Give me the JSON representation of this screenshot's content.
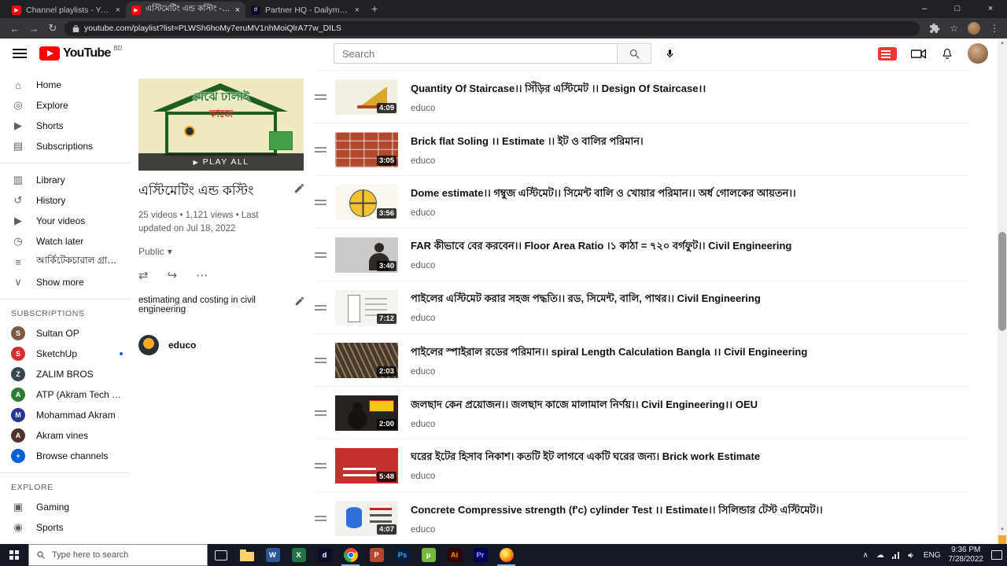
{
  "browser": {
    "tabs": [
      {
        "id": "channel-playlists",
        "title": "Channel playlists - YouTube Stud",
        "favicon_color": "#ff0000",
        "favicon_glyph": "▶",
        "active": false
      },
      {
        "id": "playlist",
        "title": "এস্টিমেটিং এন্ড কস্টিং - YouTube",
        "favicon_color": "#ff0000",
        "favicon_glyph": "▶",
        "active": true
      },
      {
        "id": "dailymotion",
        "title": "Partner HQ - Dailymotion",
        "favicon_color": "#0d0d2b",
        "favicon_glyph": "d",
        "active": false
      }
    ],
    "url": "youtube.com/playlist?list=PLWSh6hoMy7eruMV1nhMoiQlrA77w_DILS",
    "nav": {
      "back": "←",
      "forward": "→",
      "reload": "↻"
    },
    "controls": {
      "minimize": "–",
      "maximize": "□",
      "close": "×",
      "new_tab": "+",
      "close_tab": "×"
    },
    "toolbar_icons": {
      "star": "☆",
      "menu": "⋮"
    }
  },
  "header": {
    "logo_text": "YouTube",
    "country": "BD",
    "search_placeholder": "Search"
  },
  "sidebar": {
    "main": [
      {
        "id": "home",
        "label": "Home",
        "glyph": "⌂"
      },
      {
        "id": "explore",
        "label": "Explore",
        "glyph": "◎"
      },
      {
        "id": "shorts",
        "label": "Shorts",
        "glyph": "▶"
      },
      {
        "id": "subscriptions",
        "label": "Subscriptions",
        "glyph": "▤"
      }
    ],
    "library": [
      {
        "id": "library",
        "label": "Library",
        "glyph": "▥"
      },
      {
        "id": "history",
        "label": "History",
        "glyph": "↺"
      },
      {
        "id": "your-videos",
        "label": "Your videos",
        "glyph": "▶"
      },
      {
        "id": "watch-later",
        "label": "Watch later",
        "glyph": "◷"
      },
      {
        "id": "architectural-graphics",
        "label": "আর্কিটেকচারাল গ্রাফিক্স",
        "glyph": "≡"
      },
      {
        "id": "show-more",
        "label": "Show more",
        "glyph": "∨"
      }
    ],
    "subscriptions_title": "SUBSCRIPTIONS",
    "subscriptions": [
      {
        "id": "sultan-op",
        "name": "Sultan OP",
        "color": "#7d5a44",
        "initial": "S",
        "new_dot": false
      },
      {
        "id": "sketchup",
        "name": "SketchUp",
        "color": "#d32f2f",
        "initial": "S",
        "new_dot": true
      },
      {
        "id": "zalim-bros",
        "name": "ZALIM BROS",
        "color": "#37474f",
        "initial": "Z",
        "new_dot": false
      },
      {
        "id": "atp-akram-tech",
        "name": "ATP (Akram Tech Poi...",
        "color": "#2e7d32",
        "initial": "A",
        "new_dot": false
      },
      {
        "id": "mohammad-akram",
        "name": "Mohammad Akram",
        "color": "#283593",
        "initial": "M",
        "new_dot": false
      },
      {
        "id": "akram-vines",
        "name": "Akram vines",
        "color": "#4e342e",
        "initial": "A",
        "new_dot": false
      },
      {
        "id": "browse-channels",
        "name": "Browse channels",
        "color": "#065fd4",
        "initial": "+",
        "new_dot": false
      }
    ],
    "explore_title": "EXPLORE",
    "explore": [
      {
        "id": "gaming",
        "label": "Gaming",
        "glyph": "▣"
      },
      {
        "id": "sports",
        "label": "Sports",
        "glyph": "◉"
      }
    ]
  },
  "playlist": {
    "title": "এস্টিমেটিং এন্ড কস্টিং",
    "stats": "25 videos • 1,121 views • Last updated on Jul 18, 2022",
    "visibility": "Public",
    "description": "estimating and costing in civil engineering",
    "channel_name": "educo",
    "play_all": "PLAY ALL",
    "hero": {
      "bg": "#efe9c0",
      "text1": "মেঝে ঢালাই",
      "text2": "কাজে",
      "text1_color": "#2e7d32",
      "text2_color": "#d32f2f",
      "badge_color": "#43a047"
    }
  },
  "glyphs": {
    "shuffle": "⇄",
    "share": "↪",
    "more": "⋯",
    "chevron_down": "▾",
    "play": "▶",
    "tray_chevron": "∧",
    "tray_cloud": "☁",
    "sb_up": "▲",
    "sb_down": "▼"
  },
  "videos": [
    {
      "title": "Quantity Of Staircase।। সিঁড়ির এস্টিমেট ।। Design Of Staircase।।",
      "channel": "educo",
      "duration": "4:09",
      "thumb": {
        "bg": "#f3efe4",
        "motif": "stairs",
        "accent": "#d9a62e"
      }
    },
    {
      "title": "Brick flat Soling ।। Estimate ।। ইট ও বালির পরিমান।",
      "channel": "educo",
      "duration": "3:05",
      "thumb": {
        "bg": "#b0492d",
        "motif": "bricks",
        "accent": "#ffffff"
      }
    },
    {
      "title": "Dome estimate।। গম্বুজ এস্টিমেট।। সিমেন্ট বালি ও খোয়ার পরিমান।। অর্ধ গোলকের আয়তন।।",
      "channel": "educo",
      "duration": "3:56",
      "thumb": {
        "bg": "#faf7ee",
        "motif": "dome",
        "accent": "#f2c230"
      }
    },
    {
      "title": "FAR কীভাবে বের করবেন।। Floor Area Ratio ।১ কাঠা = ৭২০ বর্গফুট।। Civil Engineering",
      "channel": "educo",
      "duration": "3:40",
      "thumb": {
        "bg": "#c9c9c7",
        "motif": "person",
        "accent": "#2f2a26"
      }
    },
    {
      "title": "পাইলের এস্টিমেট করার সহজ পদ্ধতি।। রড, সিমেন্ট, বালি, পাথর।। Civil Engineering",
      "channel": "educo",
      "duration": "7:12",
      "thumb": {
        "bg": "#f5f4f0",
        "motif": "drawing",
        "accent": "#9a9a9a"
      }
    },
    {
      "title": "পাইলের স্পাইরাল রডের পরিমান।। spiral Length Calculation Bangla ।। Civil Engineering",
      "channel": "educo",
      "duration": "2:03",
      "thumb": {
        "bg": "#433a31",
        "motif": "spiral",
        "accent": "#9a7a52"
      }
    },
    {
      "title": "জলছাদ কেন প্রয়োজন।। জলছাদ কাজে মালামাল নির্ণয়।। Civil Engineering।। OEU",
      "channel": "educo",
      "duration": "2:00",
      "thumb": {
        "bg": "#262220",
        "motif": "presenter",
        "accent": "#f5c518"
      }
    },
    {
      "title": "ঘরের ইটের হিসাব নিকাশ। কতটি ইট লাগবে একটি ঘরের জন্য। Brick work Estimate",
      "channel": "educo",
      "duration": "5:48",
      "thumb": {
        "bg": "#c4302b",
        "motif": "redtext",
        "accent": "#ffffff"
      }
    },
    {
      "title": "Concrete Compressive strength (f'c) cylinder Test ।। Estimate।। সিলিন্ডার টেস্ট এস্টিমেট।।",
      "channel": "educo",
      "duration": "4:07",
      "thumb": {
        "bg": "#f2f1ec",
        "motif": "cylinder",
        "accent": "#2e6fd8"
      }
    }
  ],
  "taskbar": {
    "search_placeholder": "Type here to search",
    "apps": [
      {
        "id": "taskview",
        "name": "task-view"
      },
      {
        "id": "explorer",
        "name": "file-explorer"
      },
      {
        "id": "letter",
        "name": "word",
        "label": "W",
        "bg": "#2b579a",
        "fg": "#ffffff"
      },
      {
        "id": "letter",
        "name": "excel",
        "label": "X",
        "bg": "#217346",
        "fg": "#ffffff"
      },
      {
        "id": "letter",
        "name": "dailymotion",
        "label": "d",
        "bg": "#0d0d2b",
        "fg": "#ffffff"
      },
      {
        "id": "chrome",
        "name": "chrome",
        "active": true
      },
      {
        "id": "letter",
        "name": "powerpoint",
        "label": "P",
        "bg": "#b7472a",
        "fg": "#ffffff"
      },
      {
        "id": "letter",
        "name": "photoshop",
        "label": "Ps",
        "bg": "#001e36",
        "fg": "#31a8ff"
      },
      {
        "id": "letter",
        "name": "utorrent",
        "label": "µ",
        "bg": "#76b83f",
        "fg": "#ffffff"
      },
      {
        "id": "letter",
        "name": "illustrator",
        "label": "Ai",
        "bg": "#330000",
        "fg": "#ff9a00"
      },
      {
        "id": "letter",
        "name": "premiere",
        "label": "Pr",
        "bg": "#00005b",
        "fg": "#9999ff"
      },
      {
        "id": "firefox",
        "name": "firefox",
        "active": true
      }
    ],
    "tray": {
      "lang": "ENG",
      "time": "9:36 PM",
      "date": "7/28/2022"
    }
  }
}
